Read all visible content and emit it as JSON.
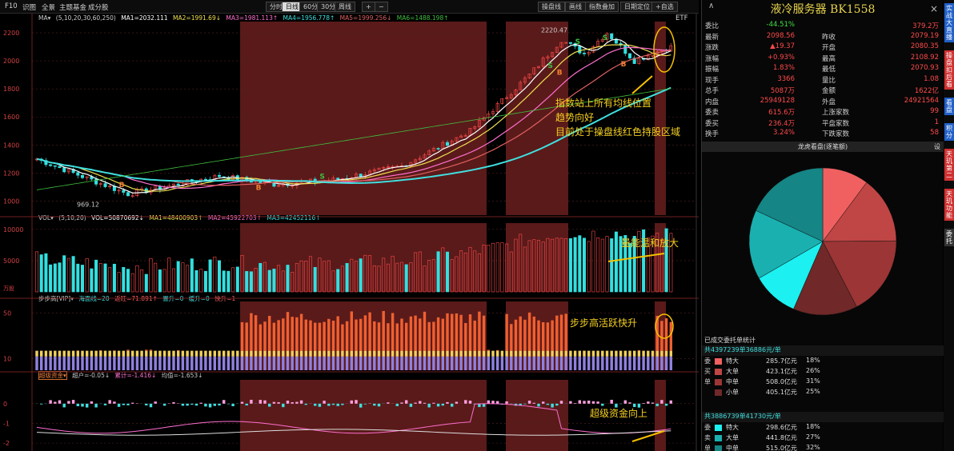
{
  "toolbar": {
    "items": [
      "F10",
      "识图",
      "全景",
      "主题基金",
      "成分股"
    ],
    "periods": [
      "分时",
      "日线",
      "60分",
      "30分",
      "周线"
    ],
    "active_period": "日线",
    "plus": "+",
    "minus": "−",
    "tools": [
      "操盘线",
      "画线",
      "指数叠加",
      "日期定位",
      "+自选",
      "ETF"
    ]
  },
  "ma_line": {
    "label": "MA▾",
    "params": "(5,10,20,30,60,250)",
    "ma1": "MA1=2032.111",
    "ma2": "MA2=1991.69↓",
    "ma3": "MA3=1981.113↑",
    "ma4": "MA4=1956.778↑",
    "ma5": "MA5=1999.256↓",
    "ma6": "MA6=1488.198↑"
  },
  "vol_line": {
    "label": "VOL▾",
    "params": "(5,10,20)",
    "vol": "VOL=50870692↓",
    "ma1": "MA1=48400903↑",
    "ma2": "MA2=45922703↑",
    "ma3": "MA3=42452116↑"
  },
  "bbg_line": {
    "label": "步步高[VIP]▾",
    "a": "海面线=20",
    "b": "返旺=71.891↑",
    "c": "置升=0",
    "d": "缓升=0",
    "e": "快升=1"
  },
  "fund_line": {
    "label": "超级资金▾",
    "a": "超户=-0.05↓",
    "b": "累计=-1.416↓",
    "c": "均值=-1.653↓"
  },
  "price_axis": [
    "2200",
    "2000",
    "1800",
    "1600",
    "1400",
    "1200",
    "1000"
  ],
  "vol_axis": [
    "10000",
    "5000"
  ],
  "vol_unit": "万股",
  "bbg_axis": [
    "50",
    "10"
  ],
  "fund_axis": [
    "0",
    "-1",
    "-2"
  ],
  "high_label": "2220.47",
  "low_label": "969.12",
  "annotations": {
    "a1": "指数站上所有均线位置",
    "a2": "趋势向好",
    "a3": "目前处于操盘线红色持股区域",
    "vol": "量能温和放大",
    "bbg": "步步高活跃快升",
    "fund": "超级资金向上"
  },
  "panel": {
    "left_tag": "∧",
    "name": "液冷服务器",
    "code": "BK1558",
    "close": "×",
    "quote": [
      [
        "委比",
        "-44.51%",
        "",
        "379.2万"
      ],
      [
        "最新",
        "2098.56",
        "昨收",
        "2079.19"
      ],
      [
        "涨跌",
        "▲19.37",
        "开盘",
        "2080.35"
      ],
      [
        "涨幅",
        "+0.93%",
        "最高",
        "2108.92"
      ],
      [
        "振幅",
        "1.83%",
        "最低",
        "2070.93"
      ],
      [
        "现手",
        "3366",
        "量比",
        "1.08"
      ],
      [
        "总手",
        "5087万",
        "金额",
        "1622亿"
      ],
      [
        "内盘",
        "25949128",
        "外盘",
        "24921564"
      ],
      [
        "委卖",
        "615.6万",
        "上涨家数",
        "99"
      ],
      [
        "委买",
        "236.4万",
        "平盘家数",
        "1"
      ],
      [
        "换手",
        "3.24%",
        "下跌家数",
        "58"
      ]
    ],
    "pie_title": "龙虎看盘(逐笔额)",
    "pie_btn": "设",
    "orders_title": "已成交委托单统计",
    "buy_total": "共4397239单36886元/单",
    "buy_side": [
      "委",
      "买",
      "单"
    ],
    "buy": [
      [
        "特大",
        "285.7亿元",
        "18%",
        "#f06060"
      ],
      [
        "大单",
        "423.1亿元",
        "26%",
        "#c04545"
      ],
      [
        "中单",
        "508.0亿元",
        "31%",
        "#9c3535"
      ],
      [
        "小单",
        "405.1亿元",
        "25%",
        "#702828"
      ]
    ],
    "sell_total": "共3886739单41730元/单",
    "sell_side": [
      "委",
      "卖",
      "单"
    ],
    "sell": [
      [
        "特大",
        "298.6亿元",
        "18%",
        "#1cf0f0"
      ],
      [
        "大单",
        "441.8亿元",
        "27%",
        "#1ab0b0"
      ],
      [
        "中单",
        "515.0亿元",
        "32%",
        "#158585"
      ]
    ]
  },
  "pie_values": [
    18,
    26,
    31,
    25,
    18,
    27,
    32
  ],
  "pie_colors": [
    "#f06060",
    "#c04545",
    "#9c3535",
    "#702828",
    "#1cf0f0",
    "#1ab0b0",
    "#158585"
  ],
  "side_tabs": [
    [
      "实战大直播",
      "#2060c8"
    ],
    [
      "操盘扣后看",
      "#d03030"
    ],
    [
      "看盘",
      "#2060c8"
    ],
    [
      "积分",
      "#2060c8"
    ],
    [
      "天玑第二",
      "#d03030"
    ],
    [
      "天玑功能",
      "#d03030"
    ],
    [
      "委托",
      "#333333"
    ]
  ],
  "colors": {
    "up": "#ff4a4a",
    "down": "#33e0e0",
    "ma1": "#ffffff",
    "ma2": "#f0e050",
    "ma3": "#ff6fd0",
    "ma4": "#40e0e0",
    "ma5": "#e06060",
    "ma6": "#40c040",
    "hold_zone": "#5a1a1a"
  }
}
